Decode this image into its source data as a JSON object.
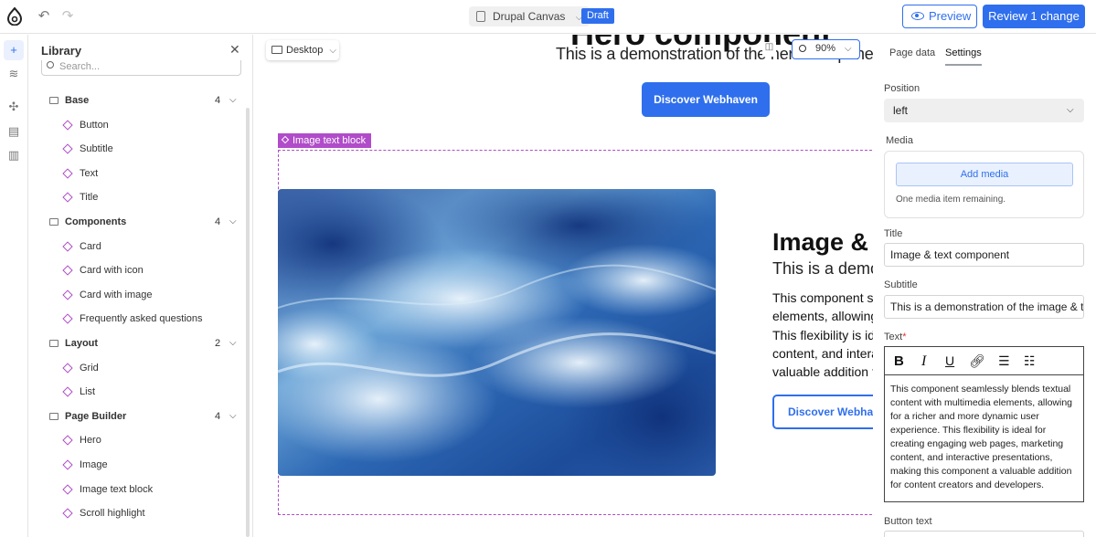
{
  "topbar": {
    "project_name": "Drupal Canvas",
    "status_badge": "Draft",
    "preview_label": "Preview",
    "review_label": "Review 1 change"
  },
  "library": {
    "title": "Library",
    "search_placeholder": "Search...",
    "folders": [
      {
        "name": "Base",
        "count": "4",
        "items": [
          "Button",
          "Subtitle",
          "Text",
          "Title"
        ]
      },
      {
        "name": "Components",
        "count": "4",
        "items": [
          "Card",
          "Card with icon",
          "Card with image",
          "Frequently asked questions"
        ]
      },
      {
        "name": "Layout",
        "count": "2",
        "items": [
          "Grid",
          "List"
        ]
      },
      {
        "name": "Page Builder",
        "count": "4",
        "items": [
          "Hero",
          "Image",
          "Image text block",
          "Scroll highlight"
        ]
      }
    ]
  },
  "canvas": {
    "device": "Desktop",
    "zoom": "90%",
    "hero_title": "Hero component",
    "hero_subtitle": "This is a demonstration of the hero component",
    "hero_button": "Discover Webhaven",
    "selected_label": "Image text block",
    "it_title": "Image & text component",
    "it_subtitle": "This is a demonstration of the image & text component",
    "it_body_lines": [
      "This component seamlessly",
      "elements, allowing for a ric",
      "This flexibility is ideal for c",
      "content, and interactive p",
      "valuable addition for cont"
    ],
    "it_button": "Discover Webhaven"
  },
  "panel": {
    "tabs": [
      "Page data",
      "Settings"
    ],
    "active_tab": "Settings",
    "position_label": "Position",
    "position_value": "left",
    "media_label": "Media",
    "add_media": "Add media",
    "media_note": "One media item remaining.",
    "title_label": "Title",
    "title_value": "Image & text component",
    "subtitle_label": "Subtitle",
    "subtitle_value": "This is a demonstration of the image & text component",
    "text_label": "Text",
    "text_required": "*",
    "text_lines": [
      "This component seamlessly blends textual",
      "content with multimedia elements, allowing",
      "for a richer and more dynamic user",
      "experience. This flexibility is ideal for",
      "creating engaging web pages, marketing",
      "content, and interactive presentations,",
      "making this component a valuable addition",
      "for content creators and developers."
    ],
    "button_text_label": "Button text"
  },
  "colors": {
    "accent": "#2f6fed",
    "component_purple": "#b04cc9"
  }
}
